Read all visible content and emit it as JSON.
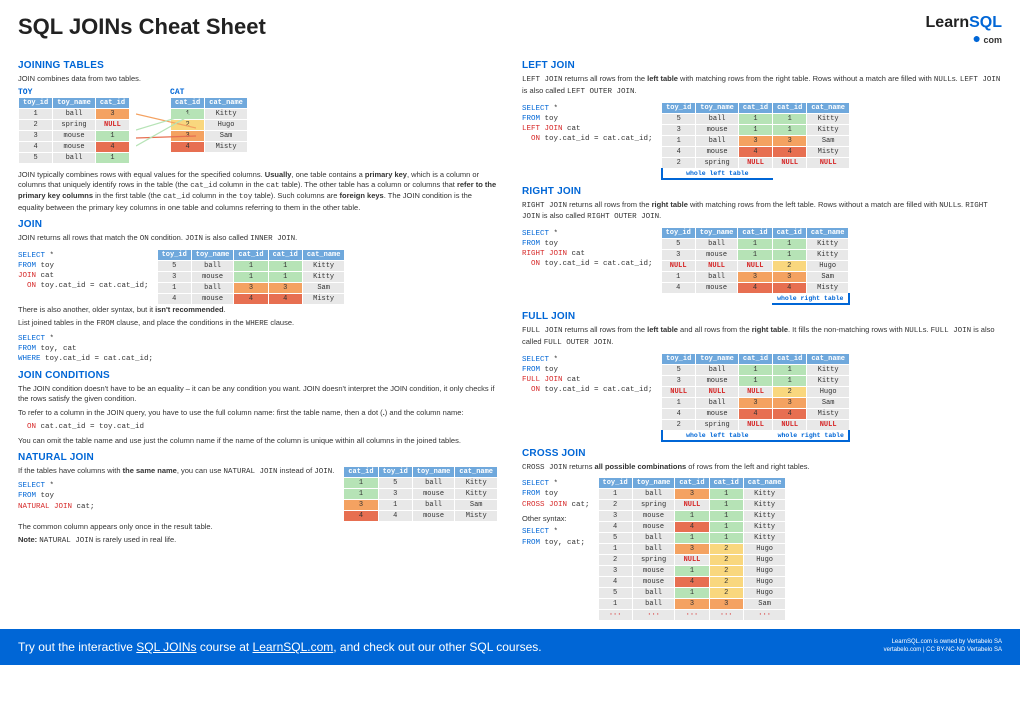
{
  "title": "SQL JOINs Cheat Sheet",
  "logo": {
    "learn": "Learn",
    "sql": "SQL",
    "dot": "●",
    "com": " com"
  },
  "sections": {
    "joining_tables": {
      "h": "JOINING TABLES",
      "p1": "JOIN combines data from two tables."
    },
    "toy_label": "TOY",
    "cat_label": "CAT",
    "joining_p2": "JOIN typically combines rows with equal values for the specified columns. Usually, one table contains a primary key, which is a column or columns that uniquely identify rows in the table (the cat_id column in the cat table). The other table has a column or columns that refer to the primary key columns in the first table (the cat_id column in the toy table). Such columns are foreign keys. The JOIN condition is the equality between the primary key columns in one table and columns referring to them in the other table.",
    "join": {
      "h": "JOIN",
      "p1": "JOIN returns all rows that match the ON condition. JOIN is also called INNER JOIN."
    },
    "join_sql": "SELECT *\nFROM toy\nJOIN cat\n  ON toy.cat_id = cat.cat_id;",
    "join_p2a": "There is also another, older syntax, but it isn't recommended.",
    "join_p2b": "List joined tables in the FROM clause, and place the conditions in the WHERE clause.",
    "join_sql2": "SELECT *\nFROM toy, cat\nWHERE toy.cat_id = cat.cat_id;",
    "join_cond": {
      "h": "JOIN CONDITIONS",
      "p1": "The JOIN condition doesn't have to be an equality – it can be any condition you want. JOIN doesn't interpret the JOIN condition, it only checks if the rows satisfy the given condition.",
      "p2a": "To refer to a column in the JOIN query, you have to use the full column name: first the table name, then a dot (.) and the column name:",
      "code": "ON cat.cat_id = toy.cat_id",
      "p2b": "You can omit the table name and use just the column name if the name of the column is unique within all columns in the joined tables."
    },
    "natural": {
      "h": "NATURAL JOIN",
      "p1": "If the tables have columns with the same name, you can use NATURAL JOIN instead of JOIN.",
      "sql": "SELECT *\nFROM toy\nNATURAL JOIN cat;",
      "p2": "The common column appears only once in the result table.",
      "p3": "Note: NATURAL JOIN is rarely used in real life."
    },
    "left": {
      "h": "LEFT JOIN",
      "p1": "LEFT JOIN returns all rows from the left table with matching rows from the right table. Rows without a match are filled with NULLs. LEFT JOIN is also called LEFT OUTER JOIN.",
      "sql": "SELECT *\nFROM toy\nLEFT JOIN cat\n  ON toy.cat_id = cat.cat_id;"
    },
    "right": {
      "h": "RIGHT JOIN",
      "p1": "RIGHT JOIN returns all rows from the right table with matching rows from the left table. Rows without a match are filled with NULLs. RIGHT JOIN is also called RIGHT OUTER JOIN.",
      "sql": "SELECT *\nFROM toy\nRIGHT JOIN cat\n  ON toy.cat_id = cat.cat_id;"
    },
    "full": {
      "h": "FULL JOIN",
      "p1": "FULL JOIN returns all rows from the left table and all rows from the right table. It fills the non-matching rows with NULLs. FULL JOIN is also called FULL OUTER JOIN.",
      "sql": "SELECT *\nFROM toy\nFULL JOIN cat\n  ON toy.cat_id = cat.cat_id;"
    },
    "cross": {
      "h": "CROSS JOIN",
      "p1": "CROSS JOIN returns all possible combinations of rows from the left and right tables.",
      "sql": "SELECT *\nFROM toy\nCROSS JOIN cat;",
      "other": "Other syntax:",
      "sql2": "SELECT *\nFROM toy, cat;"
    }
  },
  "tables": {
    "toy": {
      "headers": [
        "toy_id",
        "toy_name",
        "cat_id"
      ],
      "rows": [
        [
          "1",
          "ball",
          "3"
        ],
        [
          "2",
          "spring",
          "NULL"
        ],
        [
          "3",
          "mouse",
          "1"
        ],
        [
          "4",
          "mouse",
          "4"
        ],
        [
          "5",
          "ball",
          "1"
        ]
      ]
    },
    "cat": {
      "headers": [
        "cat_id",
        "cat_name"
      ],
      "rows": [
        [
          "1",
          "Kitty"
        ],
        [
          "2",
          "Hugo"
        ],
        [
          "3",
          "Sam"
        ],
        [
          "4",
          "Misty"
        ]
      ]
    },
    "inner_result": {
      "headers": [
        "toy_id",
        "toy_name",
        "cat_id",
        "cat_id",
        "cat_name"
      ],
      "rows": [
        [
          "5",
          "ball",
          "1",
          "1",
          "Kitty"
        ],
        [
          "3",
          "mouse",
          "1",
          "1",
          "Kitty"
        ],
        [
          "1",
          "ball",
          "3",
          "3",
          "Sam"
        ],
        [
          "4",
          "mouse",
          "4",
          "4",
          "Misty"
        ]
      ]
    },
    "natural_result": {
      "headers": [
        "cat_id",
        "toy_id",
        "toy_name",
        "cat_name"
      ],
      "rows": [
        [
          "1",
          "5",
          "ball",
          "Kitty"
        ],
        [
          "1",
          "3",
          "mouse",
          "Kitty"
        ],
        [
          "3",
          "1",
          "ball",
          "Sam"
        ],
        [
          "4",
          "4",
          "mouse",
          "Misty"
        ]
      ]
    },
    "left_result": {
      "headers": [
        "toy_id",
        "toy_name",
        "cat_id",
        "cat_id",
        "cat_name"
      ],
      "rows": [
        [
          "5",
          "ball",
          "1",
          "1",
          "Kitty"
        ],
        [
          "3",
          "mouse",
          "1",
          "1",
          "Kitty"
        ],
        [
          "1",
          "ball",
          "3",
          "3",
          "Sam"
        ],
        [
          "4",
          "mouse",
          "4",
          "4",
          "Misty"
        ],
        [
          "2",
          "spring",
          "NULL",
          "NULL",
          "NULL"
        ]
      ],
      "label": "whole left table"
    },
    "right_result": {
      "headers": [
        "toy_id",
        "toy_name",
        "cat_id",
        "cat_id",
        "cat_name"
      ],
      "rows": [
        [
          "5",
          "ball",
          "1",
          "1",
          "Kitty"
        ],
        [
          "3",
          "mouse",
          "1",
          "1",
          "Kitty"
        ],
        [
          "NULL",
          "NULL",
          "NULL",
          "2",
          "Hugo"
        ],
        [
          "1",
          "ball",
          "3",
          "3",
          "Sam"
        ],
        [
          "4",
          "mouse",
          "4",
          "4",
          "Misty"
        ]
      ],
      "label": "whole right table"
    },
    "full_result": {
      "headers": [
        "toy_id",
        "toy_name",
        "cat_id",
        "cat_id",
        "cat_name"
      ],
      "rows": [
        [
          "5",
          "ball",
          "1",
          "1",
          "Kitty"
        ],
        [
          "3",
          "mouse",
          "1",
          "1",
          "Kitty"
        ],
        [
          "NULL",
          "NULL",
          "NULL",
          "2",
          "Hugo"
        ],
        [
          "1",
          "ball",
          "3",
          "3",
          "Sam"
        ],
        [
          "4",
          "mouse",
          "4",
          "4",
          "Misty"
        ],
        [
          "2",
          "spring",
          "NULL",
          "NULL",
          "NULL"
        ]
      ],
      "label_l": "whole left table",
      "label_r": "whole right table"
    },
    "cross_result": {
      "headers": [
        "toy_id",
        "toy_name",
        "cat_id",
        "cat_id",
        "cat_name"
      ],
      "rows": [
        [
          "1",
          "ball",
          "3",
          "1",
          "Kitty"
        ],
        [
          "2",
          "spring",
          "NULL",
          "1",
          "Kitty"
        ],
        [
          "3",
          "mouse",
          "1",
          "1",
          "Kitty"
        ],
        [
          "4",
          "mouse",
          "4",
          "1",
          "Kitty"
        ],
        [
          "5",
          "ball",
          "1",
          "1",
          "Kitty"
        ],
        [
          "1",
          "ball",
          "3",
          "2",
          "Hugo"
        ],
        [
          "2",
          "spring",
          "NULL",
          "2",
          "Hugo"
        ],
        [
          "3",
          "mouse",
          "1",
          "2",
          "Hugo"
        ],
        [
          "4",
          "mouse",
          "4",
          "2",
          "Hugo"
        ],
        [
          "5",
          "ball",
          "1",
          "2",
          "Hugo"
        ],
        [
          "1",
          "ball",
          "3",
          "3",
          "Sam"
        ],
        [
          "···",
          "···",
          "···",
          "···",
          "···"
        ]
      ]
    }
  },
  "footer": {
    "main_a": "Try out the interactive ",
    "main_b": "SQL JOINs",
    "main_c": " course at ",
    "main_d": "LearnSQL.com",
    "main_e": ", and check out our other SQL courses.",
    "legal1": "LearnSQL.com is owned by Vertabelo SA",
    "legal2": "vertabelo.com | CC BY-NC-ND Vertabelo SA"
  }
}
